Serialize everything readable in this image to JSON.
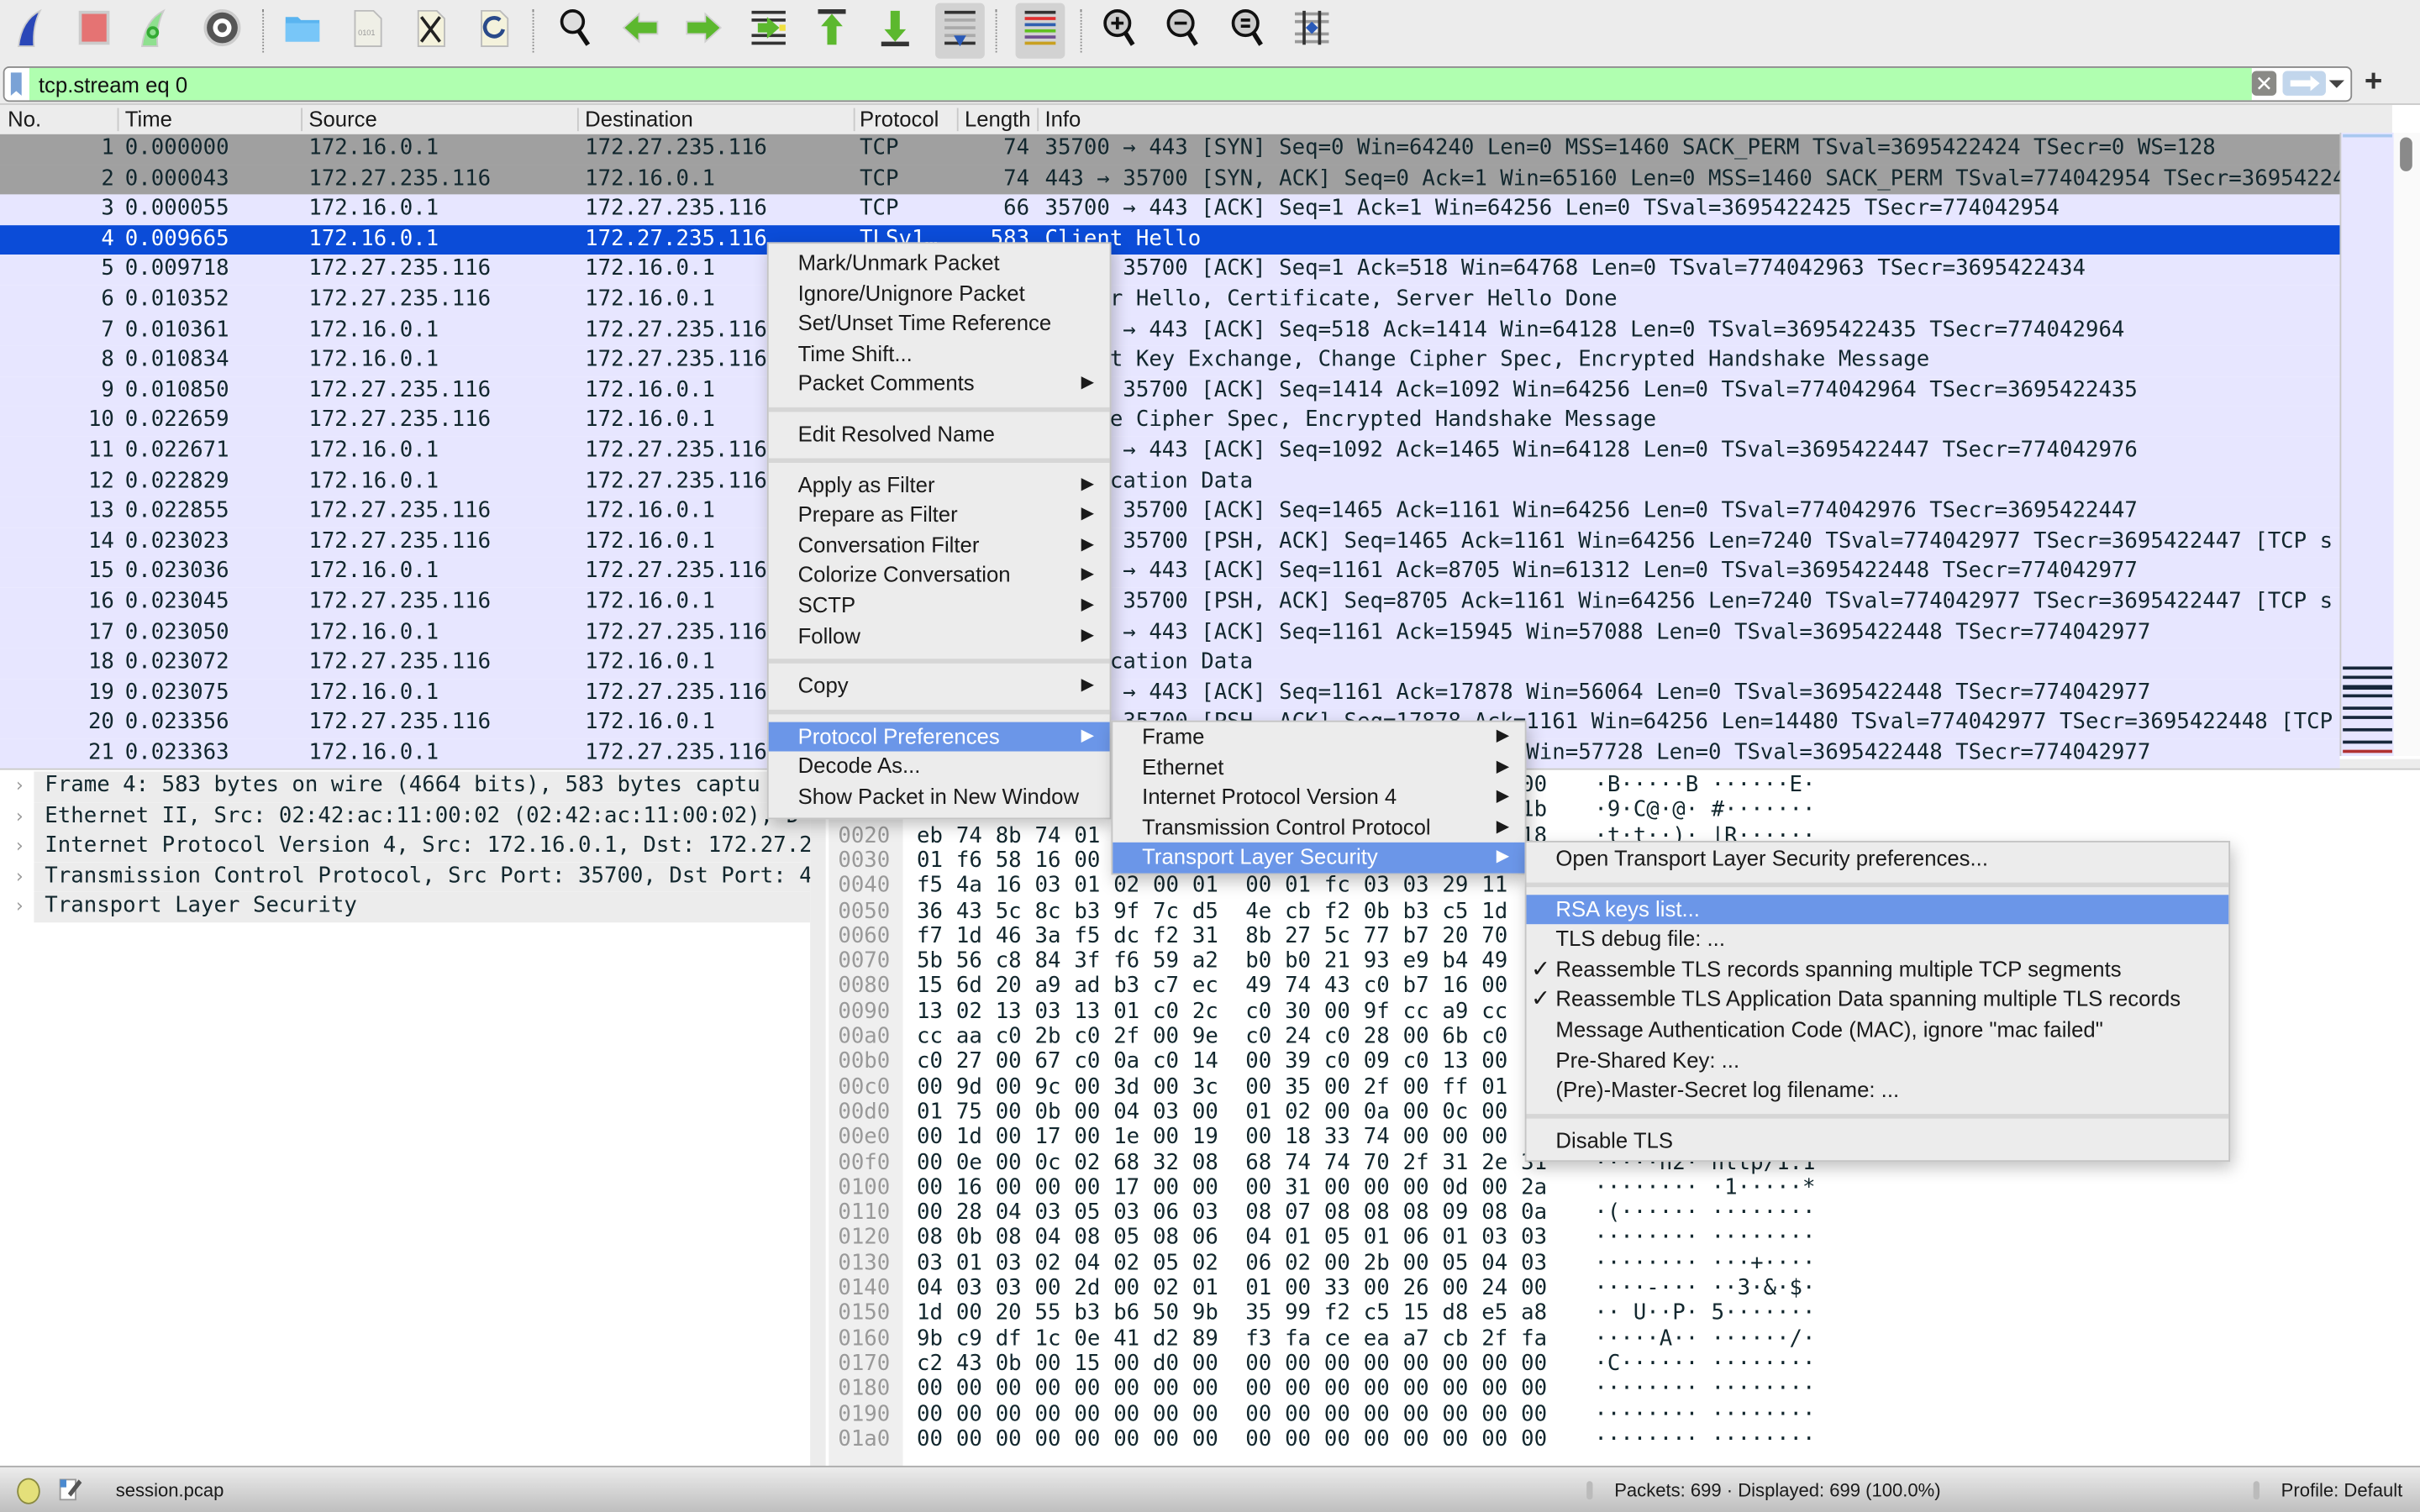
{
  "toolbar": {
    "groups": [
      [
        "start-capture-icon",
        "stop-capture-icon",
        "restart-capture-icon",
        "capture-options-icon"
      ],
      [
        "open-file-icon",
        "save-file-icon",
        "close-file-icon",
        "reload-file-icon"
      ],
      [
        "find-packet-icon",
        "go-back-icon",
        "go-forward-icon",
        "go-to-packet-icon",
        "go-first-icon",
        "go-last-icon",
        "autoscroll-icon"
      ],
      [
        "colorize-icon"
      ],
      [
        "zoom-in-icon",
        "zoom-out-icon",
        "zoom-normal-icon",
        "resize-columns-icon"
      ]
    ],
    "pressed": [
      "autoscroll-icon",
      "colorize-icon"
    ]
  },
  "filter": {
    "value": "tcp.stream eq 0",
    "clear_label": "✕",
    "add_label": "+",
    "color": "#b0ffb0"
  },
  "packet_list": {
    "columns": [
      "No.",
      "Time",
      "Source",
      "Destination",
      "Protocol",
      "Length",
      "Info"
    ],
    "rows": [
      {
        "no": "1",
        "time": "0.000000",
        "src": "172.16.0.1",
        "dst": "172.27.235.116",
        "proto": "TCP",
        "len": "74",
        "info": "35700 → 443 [SYN] Seq=0 Win=64240 Len=0 MSS=1460 SACK_PERM TSval=3695422424 TSecr=0 WS=128",
        "style": "syn"
      },
      {
        "no": "2",
        "time": "0.000043",
        "src": "172.27.235.116",
        "dst": "172.16.0.1",
        "proto": "TCP",
        "len": "74",
        "info": "443 → 35700 [SYN, ACK] Seq=0 Ack=1 Win=65160 Len=0 MSS=1460 SACK_PERM TSval=774042954 TSecr=3695422424",
        "style": "syn"
      },
      {
        "no": "3",
        "time": "0.000055",
        "src": "172.16.0.1",
        "dst": "172.27.235.116",
        "proto": "TCP",
        "len": "66",
        "info": "35700 → 443 [ACK] Seq=1 Ack=1 Win=64256 Len=0 TSval=3695422425 TSecr=774042954",
        "style": "normal"
      },
      {
        "no": "4",
        "time": "0.009665",
        "src": "172.16.0.1",
        "dst": "172.27.235.116",
        "proto": "TLSv1…",
        "len": "583",
        "info": "Client Hello",
        "style": "selected"
      },
      {
        "no": "5",
        "time": "0.009718",
        "src": "172.27.235.116",
        "dst": "172.16.0.1",
        "proto": "",
        "len": "",
        "info": "443 → 35700 [ACK] Seq=1 Ack=518 Win=64768 Len=0 TSval=774042963 TSecr=3695422434",
        "style": "normal"
      },
      {
        "no": "6",
        "time": "0.010352",
        "src": "172.27.235.116",
        "dst": "172.16.0.1",
        "proto": "",
        "len": "",
        "info": "Server Hello, Certificate, Server Hello Done",
        "style": "normal"
      },
      {
        "no": "7",
        "time": "0.010361",
        "src": "172.16.0.1",
        "dst": "172.27.235.116",
        "proto": "",
        "len": "",
        "info": "35700 → 443 [ACK] Seq=518 Ack=1414 Win=64128 Len=0 TSval=3695422435 TSecr=774042964",
        "style": "normal"
      },
      {
        "no": "8",
        "time": "0.010834",
        "src": "172.16.0.1",
        "dst": "172.27.235.116",
        "proto": "",
        "len": "",
        "info": "Client Key Exchange, Change Cipher Spec, Encrypted Handshake Message",
        "style": "normal"
      },
      {
        "no": "9",
        "time": "0.010850",
        "src": "172.27.235.116",
        "dst": "172.16.0.1",
        "proto": "",
        "len": "",
        "info": "443 → 35700 [ACK] Seq=1414 Ack=1092 Win=64256 Len=0 TSval=774042964 TSecr=3695422435",
        "style": "normal"
      },
      {
        "no": "10",
        "time": "0.022659",
        "src": "172.27.235.116",
        "dst": "172.16.0.1",
        "proto": "",
        "len": "",
        "info": "Change Cipher Spec, Encrypted Handshake Message",
        "style": "normal"
      },
      {
        "no": "11",
        "time": "0.022671",
        "src": "172.16.0.1",
        "dst": "172.27.235.116",
        "proto": "",
        "len": "",
        "info": "35700 → 443 [ACK] Seq=1092 Ack=1465 Win=64128 Len=0 TSval=3695422447 TSecr=774042976",
        "style": "normal"
      },
      {
        "no": "12",
        "time": "0.022829",
        "src": "172.16.0.1",
        "dst": "172.27.235.116",
        "proto": "",
        "len": "",
        "info": "Application Data",
        "style": "normal"
      },
      {
        "no": "13",
        "time": "0.022855",
        "src": "172.27.235.116",
        "dst": "172.16.0.1",
        "proto": "",
        "len": "",
        "info": "443 → 35700 [ACK] Seq=1465 Ack=1161 Win=64256 Len=0 TSval=774042976 TSecr=3695422447",
        "style": "normal"
      },
      {
        "no": "14",
        "time": "0.023023",
        "src": "172.27.235.116",
        "dst": "172.16.0.1",
        "proto": "",
        "len": "",
        "info": "443 → 35700 [PSH, ACK] Seq=1465 Ack=1161 Win=64256 Len=7240 TSval=774042977 TSecr=3695422447 [TCP s",
        "style": "normal"
      },
      {
        "no": "15",
        "time": "0.023036",
        "src": "172.16.0.1",
        "dst": "172.27.235.116",
        "proto": "",
        "len": "",
        "info": "35700 → 443 [ACK] Seq=1161 Ack=8705 Win=61312 Len=0 TSval=3695422448 TSecr=774042977",
        "style": "normal"
      },
      {
        "no": "16",
        "time": "0.023045",
        "src": "172.27.235.116",
        "dst": "172.16.0.1",
        "proto": "",
        "len": "",
        "info": "443 → 35700 [PSH, ACK] Seq=8705 Ack=1161 Win=64256 Len=7240 TSval=774042977 TSecr=3695422447 [TCP s",
        "style": "normal"
      },
      {
        "no": "17",
        "time": "0.023050",
        "src": "172.16.0.1",
        "dst": "172.27.235.116",
        "proto": "",
        "len": "",
        "info": "35700 → 443 [ACK] Seq=1161 Ack=15945 Win=57088 Len=0 TSval=3695422448 TSecr=774042977",
        "style": "normal"
      },
      {
        "no": "18",
        "time": "0.023072",
        "src": "172.27.235.116",
        "dst": "172.16.0.1",
        "proto": "",
        "len": "",
        "info": "Application Data",
        "style": "normal"
      },
      {
        "no": "19",
        "time": "0.023075",
        "src": "172.16.0.1",
        "dst": "172.27.235.116",
        "proto": "",
        "len": "",
        "info": "35700 → 443 [ACK] Seq=1161 Ack=17878 Win=56064 Len=0 TSval=3695422448 TSecr=774042977",
        "style": "normal"
      },
      {
        "no": "20",
        "time": "0.023356",
        "src": "172.27.235.116",
        "dst": "172.16.0.1",
        "proto": "",
        "len": "",
        "info": "443 → 35700 [PSH, ACK] Seq=17878 Ack=1161 Win=64256 Len=14480 TSval=774042977 TSecr=3695422448 [TCP",
        "style": "normal"
      },
      {
        "no": "21",
        "time": "0.023363",
        "src": "172.16.0.1",
        "dst": "172.27.235.116",
        "proto": "",
        "len": "",
        "info": "35700 → 443 [ACK] Seq=1161 Ack=32358 Win=57728 Len=0 TSval=3695422448 TSecr=774042977",
        "style": "normal"
      }
    ],
    "colors": {
      "syn": "#a0a0a0",
      "normal": "#e7e6ff",
      "selected": "#0b4cd8"
    }
  },
  "details": [
    "Frame 4: 583 bytes on wire (4664 bits), 583 bytes captu",
    "Ethernet II, Src: 02:42:ac:11:00:02 (02:42:ac:11:00:02), D",
    "Internet Protocol Version 4, Src: 172.16.0.1, Dst: 172.27.2",
    "Transmission Control Protocol, Src Port: 35700, Dst Port: 4",
    "Transport Layer Security"
  ],
  "bytes": [
    {
      "off": "0000",
      "hex": [
        "",
        "",
        "",
        "",
        "",
        "",
        "",
        "",
        "",
        "",
        "",
        "",
        "",
        "",
        "",
        "00"
      ],
      "ascii": "·B·····B ······E·"
    },
    {
      "off": "0010",
      "hex": [
        "",
        "",
        "",
        "",
        "",
        "",
        "",
        "",
        "",
        "",
        "",
        "",
        "",
        "",
        "",
        "1b"
      ],
      "ascii": "·9·C@·@· #·······"
    },
    {
      "off": "0020",
      "hex": [
        "eb",
        "74",
        "8b",
        "74",
        "01",
        "",
        "",
        "",
        "",
        "",
        "",
        "",
        "",
        "",
        "",
        "18"
      ],
      "ascii": "·t·t··)· |R······"
    },
    {
      "off": "0030",
      "hex": [
        "01",
        "f6",
        "58",
        "16",
        "00",
        "",
        "",
        "",
        "",
        "",
        "",
        "",
        "",
        "",
        "",
        ""
      ],
      "ascii": ""
    },
    {
      "off": "0040",
      "hex": [
        "f5",
        "4a",
        "16",
        "03",
        "01",
        "02",
        "00",
        "01",
        "00",
        "01",
        "fc",
        "03",
        "03",
        "29",
        "11",
        ""
      ],
      "ascii": ""
    },
    {
      "off": "0050",
      "hex": [
        "36",
        "43",
        "5c",
        "8c",
        "b3",
        "9f",
        "7c",
        "d5",
        "4e",
        "cb",
        "f2",
        "0b",
        "b3",
        "c5",
        "1d",
        ""
      ],
      "ascii": ""
    },
    {
      "off": "0060",
      "hex": [
        "f7",
        "1d",
        "46",
        "3a",
        "f5",
        "dc",
        "f2",
        "31",
        "8b",
        "27",
        "5c",
        "77",
        "b7",
        "20",
        "70",
        ""
      ],
      "ascii": ""
    },
    {
      "off": "0070",
      "hex": [
        "5b",
        "56",
        "c8",
        "84",
        "3f",
        "f6",
        "59",
        "a2",
        "b0",
        "b0",
        "21",
        "93",
        "e9",
        "b4",
        "49",
        ""
      ],
      "ascii": ""
    },
    {
      "off": "0080",
      "hex": [
        "15",
        "6d",
        "20",
        "a9",
        "ad",
        "b3",
        "c7",
        "ec",
        "49",
        "74",
        "43",
        "c0",
        "b7",
        "16",
        "00",
        ""
      ],
      "ascii": ""
    },
    {
      "off": "0090",
      "hex": [
        "13",
        "02",
        "13",
        "03",
        "13",
        "01",
        "c0",
        "2c",
        "c0",
        "30",
        "00",
        "9f",
        "cc",
        "a9",
        "cc",
        ""
      ],
      "ascii": ""
    },
    {
      "off": "00a0",
      "hex": [
        "cc",
        "aa",
        "c0",
        "2b",
        "c0",
        "2f",
        "00",
        "9e",
        "c0",
        "24",
        "c0",
        "28",
        "00",
        "6b",
        "c0",
        ""
      ],
      "ascii": ""
    },
    {
      "off": "00b0",
      "hex": [
        "c0",
        "27",
        "00",
        "67",
        "c0",
        "0a",
        "c0",
        "14",
        "00",
        "39",
        "c0",
        "09",
        "c0",
        "13",
        "00",
        ""
      ],
      "ascii": ""
    },
    {
      "off": "00c0",
      "hex": [
        "00",
        "9d",
        "00",
        "9c",
        "00",
        "3d",
        "00",
        "3c",
        "00",
        "35",
        "00",
        "2f",
        "00",
        "ff",
        "01",
        ""
      ],
      "ascii": ""
    },
    {
      "off": "00d0",
      "hex": [
        "01",
        "75",
        "00",
        "0b",
        "00",
        "04",
        "03",
        "00",
        "01",
        "02",
        "00",
        "0a",
        "00",
        "0c",
        "00",
        ""
      ],
      "ascii": ""
    },
    {
      "off": "00e0",
      "hex": [
        "00",
        "1d",
        "00",
        "17",
        "00",
        "1e",
        "00",
        "19",
        "00",
        "18",
        "33",
        "74",
        "00",
        "00",
        "00",
        ""
      ],
      "ascii": ""
    },
    {
      "off": "00f0",
      "hex": [
        "00",
        "0e",
        "00",
        "0c",
        "02",
        "68",
        "32",
        "08",
        "68",
        "74",
        "74",
        "70",
        "2f",
        "31",
        "2e",
        "31"
      ],
      "ascii": "·····h2· http/1.1"
    },
    {
      "off": "0100",
      "hex": [
        "00",
        "16",
        "00",
        "00",
        "00",
        "17",
        "00",
        "00",
        "00",
        "31",
        "00",
        "00",
        "00",
        "0d",
        "00",
        "2a"
      ],
      "ascii": "········ ·1·····*"
    },
    {
      "off": "0110",
      "hex": [
        "00",
        "28",
        "04",
        "03",
        "05",
        "03",
        "06",
        "03",
        "08",
        "07",
        "08",
        "08",
        "08",
        "09",
        "08",
        "0a"
      ],
      "ascii": "·(······ ········"
    },
    {
      "off": "0120",
      "hex": [
        "08",
        "0b",
        "08",
        "04",
        "08",
        "05",
        "08",
        "06",
        "04",
        "01",
        "05",
        "01",
        "06",
        "01",
        "03",
        "03"
      ],
      "ascii": "········ ········"
    },
    {
      "off": "0130",
      "hex": [
        "03",
        "01",
        "03",
        "02",
        "04",
        "02",
        "05",
        "02",
        "06",
        "02",
        "00",
        "2b",
        "00",
        "05",
        "04",
        "03"
      ],
      "ascii": "········ ···+····"
    },
    {
      "off": "0140",
      "hex": [
        "04",
        "03",
        "03",
        "00",
        "2d",
        "00",
        "02",
        "01",
        "01",
        "00",
        "33",
        "00",
        "26",
        "00",
        "24",
        "00"
      ],
      "ascii": "····-··· ··3·&·$·"
    },
    {
      "off": "0150",
      "hex": [
        "1d",
        "00",
        "20",
        "55",
        "b3",
        "b6",
        "50",
        "9b",
        "35",
        "99",
        "f2",
        "c5",
        "15",
        "d8",
        "e5",
        "a8"
      ],
      "ascii": "·· U··P· 5·······"
    },
    {
      "off": "0160",
      "hex": [
        "9b",
        "c9",
        "df",
        "1c",
        "0e",
        "41",
        "d2",
        "89",
        "f3",
        "fa",
        "ce",
        "ea",
        "a7",
        "cb",
        "2f",
        "fa"
      ],
      "ascii": "·····A·· ······/·"
    },
    {
      "off": "0170",
      "hex": [
        "c2",
        "43",
        "0b",
        "00",
        "15",
        "00",
        "d0",
        "00",
        "00",
        "00",
        "00",
        "00",
        "00",
        "00",
        "00",
        "00"
      ],
      "ascii": "·C······ ········"
    },
    {
      "off": "0180",
      "hex": [
        "00",
        "00",
        "00",
        "00",
        "00",
        "00",
        "00",
        "00",
        "00",
        "00",
        "00",
        "00",
        "00",
        "00",
        "00",
        "00"
      ],
      "ascii": "········ ········"
    },
    {
      "off": "0190",
      "hex": [
        "00",
        "00",
        "00",
        "00",
        "00",
        "00",
        "00",
        "00",
        "00",
        "00",
        "00",
        "00",
        "00",
        "00",
        "00",
        "00"
      ],
      "ascii": "········ ········"
    },
    {
      "off": "01a0",
      "hex": [
        "00",
        "00",
        "00",
        "00",
        "00",
        "00",
        "00",
        "00",
        "00",
        "00",
        "00",
        "00",
        "00",
        "00",
        "00",
        "00"
      ],
      "ascii": "········ ········"
    }
  ],
  "context_menu": [
    {
      "label": "Mark/Unmark Packet"
    },
    {
      "label": "Ignore/Unignore Packet"
    },
    {
      "label": "Set/Unset Time Reference"
    },
    {
      "label": "Time Shift..."
    },
    {
      "label": "Packet Comments",
      "submenu": true,
      "sep_after": true
    },
    {
      "label": "Edit Resolved Name",
      "sep_after": true
    },
    {
      "label": "Apply as Filter",
      "submenu": true
    },
    {
      "label": "Prepare as Filter",
      "submenu": true
    },
    {
      "label": "Conversation Filter",
      "submenu": true
    },
    {
      "label": "Colorize Conversation",
      "submenu": true
    },
    {
      "label": "SCTP",
      "submenu": true
    },
    {
      "label": "Follow",
      "submenu": true,
      "sep_after": true
    },
    {
      "label": "Copy",
      "submenu": true,
      "sep_after": true
    },
    {
      "label": "Protocol Preferences",
      "submenu": true,
      "highlighted": true
    },
    {
      "label": "Decode As..."
    },
    {
      "label": "Show Packet in New Window"
    }
  ],
  "protocol_menu": [
    {
      "label": "Frame",
      "submenu": true
    },
    {
      "label": "Ethernet",
      "submenu": true
    },
    {
      "label": "Internet Protocol Version 4",
      "submenu": true
    },
    {
      "label": "Transmission Control Protocol",
      "submenu": true
    },
    {
      "label": "Transport Layer Security",
      "submenu": true,
      "highlighted": true
    }
  ],
  "tls_menu": [
    {
      "label": "Open Transport Layer Security preferences...",
      "sep_after": true
    },
    {
      "label": "RSA keys list...",
      "highlighted": true
    },
    {
      "label": "TLS debug file: ..."
    },
    {
      "label": "Reassemble TLS records spanning multiple TCP segments",
      "checked": true
    },
    {
      "label": "Reassemble TLS Application Data spanning multiple TLS records",
      "checked": true
    },
    {
      "label": "Message Authentication Code (MAC), ignore \"mac failed\""
    },
    {
      "label": "Pre-Shared Key: ..."
    },
    {
      "label": "(Pre)-Master-Secret log filename: ...",
      "sep_after": true
    },
    {
      "label": "Disable TLS"
    }
  ],
  "menu_highlight_color": "#6b96e8",
  "status": {
    "file": "session.pcap",
    "packets": "Packets: 699 · Displayed: 699 (100.0%)",
    "profile": "Profile: Default"
  }
}
